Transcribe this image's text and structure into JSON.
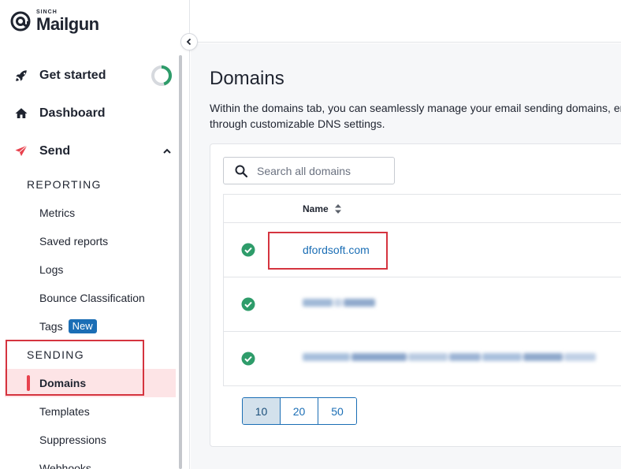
{
  "brand": {
    "top_line": "SINCH",
    "name": "Mailgun"
  },
  "sidebar": {
    "main_items": [
      {
        "label": "Get started",
        "icon": "rocket-icon"
      },
      {
        "label": "Dashboard",
        "icon": "home-icon"
      },
      {
        "label": "Send",
        "icon": "paper-plane-icon",
        "expanded": true
      }
    ],
    "get_started_progress": 0.45,
    "sections": [
      {
        "label": "REPORTING",
        "items": [
          "Metrics",
          "Saved reports",
          "Logs",
          "Bounce Classification",
          "Tags"
        ]
      },
      {
        "label": "SENDING",
        "items": [
          "Domains",
          "Templates",
          "Suppressions",
          "Webhooks"
        ]
      }
    ],
    "tags_badge": "New",
    "active_item": "Domains"
  },
  "page": {
    "title": "Domains",
    "description_line1": "Within the domains tab, you can seamlessly manage your email sending domains, er",
    "description_line2": "through customizable DNS settings."
  },
  "domains": {
    "search_placeholder": "Search all domains",
    "column_name": "Name",
    "rows": [
      {
        "name": "dfordsoft.com",
        "status": "verified"
      },
      {
        "name": "",
        "status": "verified",
        "obscured": true
      },
      {
        "name": "",
        "status": "verified",
        "obscured": true
      }
    ],
    "page_sizes": [
      "10",
      "20",
      "50"
    ],
    "selected_page_size": "10"
  },
  "colors": {
    "brand_red": "#e8424e",
    "link_blue": "#1b6eb5",
    "verified_green": "#2e9c6a",
    "highlight": "#d5343f"
  }
}
